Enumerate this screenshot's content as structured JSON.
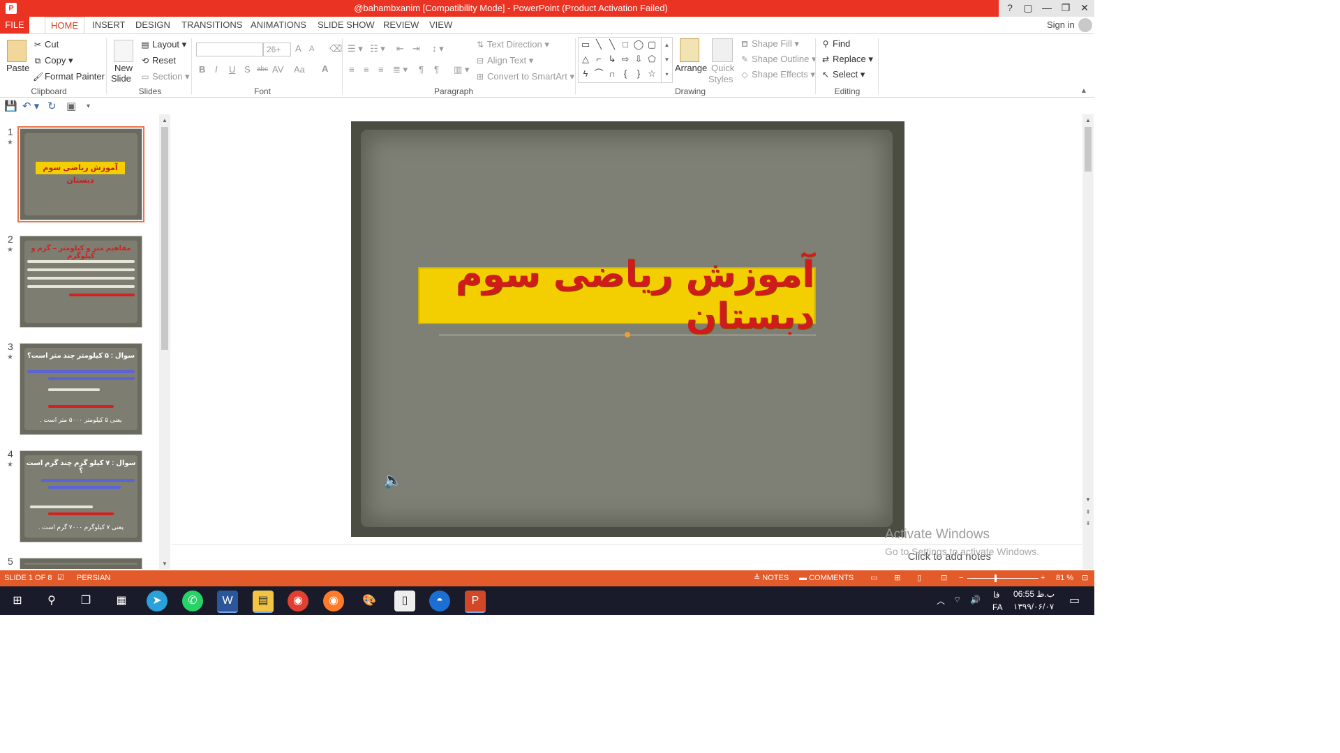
{
  "window": {
    "title": "@bahambxanim [Compatibility Mode] - PowerPoint (Product Activation Failed)",
    "controls": [
      "?",
      "▢",
      "—",
      "❐",
      "✕"
    ]
  },
  "tabs": [
    "FILE",
    "HOME",
    "INSERT",
    "DESIGN",
    "TRANSITIONS",
    "ANIMATIONS",
    "SLIDE SHOW",
    "REVIEW",
    "VIEW"
  ],
  "sign_in": "Sign in",
  "ribbon": {
    "clipboard": {
      "paste": "Paste",
      "cut": "Cut",
      "copy": "Copy",
      "format_painter": "Format Painter",
      "label": "Clipboard"
    },
    "slides": {
      "new_slide_1": "New",
      "new_slide_2": "Slide",
      "layout": "Layout",
      "reset": "Reset",
      "section": "Section",
      "label": "Slides"
    },
    "font": {
      "size": "26+",
      "bold": "B",
      "italic": "I",
      "underline": "U",
      "shadow": "S",
      "strike": "abc",
      "spacing": "AV",
      "case": "Aa",
      "color": "A",
      "grow": "A",
      "shrink": "A",
      "label": "Font"
    },
    "paragraph": {
      "text_direction": "Text Direction",
      "align_text": "Align Text",
      "convert_smartart": "Convert to SmartArt",
      "label": "Paragraph"
    },
    "drawing": {
      "arrange": "Arrange",
      "quick_styles_1": "Quick",
      "quick_styles_2": "Styles",
      "shape_fill": "Shape Fill",
      "shape_outline": "Shape Outline",
      "shape_effects": "Shape Effects",
      "label": "Drawing"
    },
    "editing": {
      "find": "Find",
      "replace": "Replace",
      "select": "Select",
      "label": "Editing"
    }
  },
  "thumbnails": [
    {
      "num": "1",
      "title": "آموزش ریاضی سوم دبستان"
    },
    {
      "num": "2",
      "title": "مفاهیم متر و کیلومتر – گرم و کیلوگرم"
    },
    {
      "num": "3",
      "title": "سوال : ۵ کیلومتر چند متر است؟",
      "footer": "یعنی ۵ کیلومتر ۵۰۰۰ متر است ."
    },
    {
      "num": "4",
      "title": "سوال : ۷ کیلو گرم چند گرم است ؟",
      "footer": "یعنی ۷ کیلوگرم ۷۰۰۰ گرم است ."
    },
    {
      "num": "5"
    }
  ],
  "slide": {
    "title": "آموزش ریاضی سوم دبستان"
  },
  "notes": {
    "placeholder": "Click to add notes"
  },
  "watermark": {
    "line1": "Activate Windows",
    "line2": "Go to Settings to activate Windows."
  },
  "status": {
    "slide": "SLIDE 1 OF 8",
    "language": "PERSIAN",
    "notes": "NOTES",
    "comments": "COMMENTS",
    "zoom": "81 %"
  },
  "tray": {
    "lang": "FA",
    "ime": "فا",
    "time": "06:55 ب.ظ",
    "date": "۱۳۹۹/۰۶/۰۷"
  },
  "colors": {
    "accent": "#ea3323",
    "status": "#e35b2a",
    "slide_title_bg": "#f3ce00",
    "slide_title_text": "#d11b1b"
  }
}
